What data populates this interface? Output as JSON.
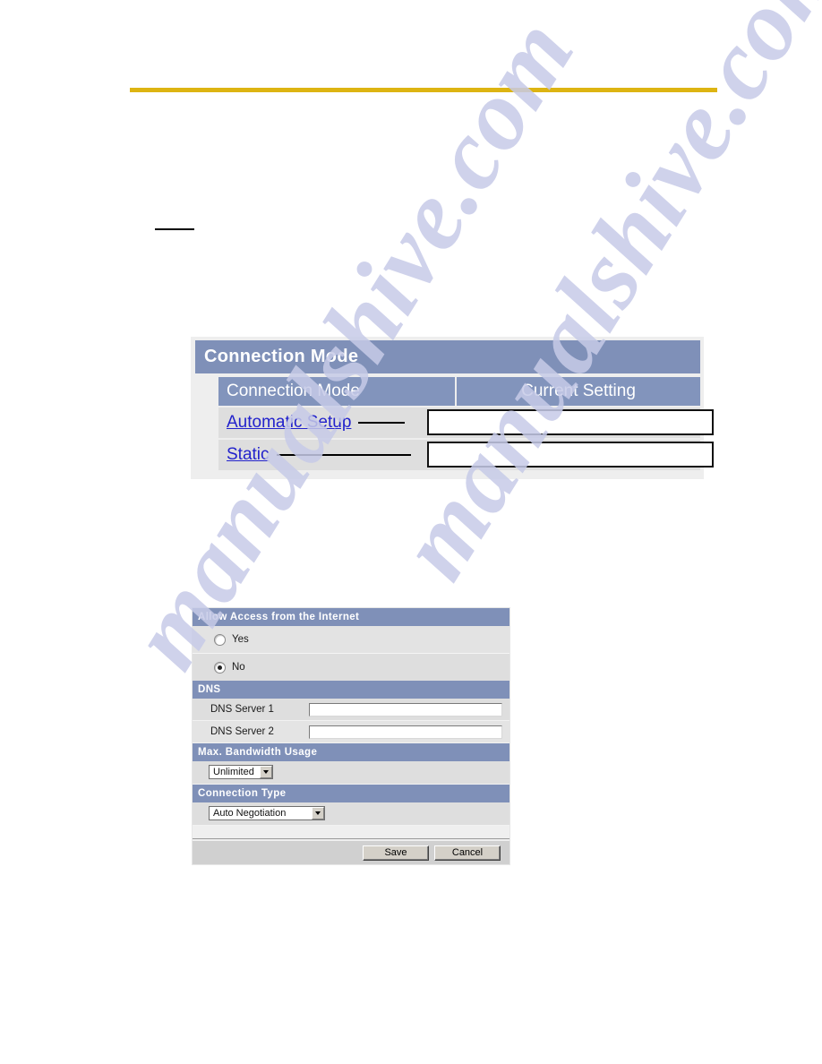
{
  "page": {
    "top_rule_color": "#ddb412",
    "watermark_text": "manualshive.com"
  },
  "connection_mode_panel": {
    "title": "Connection Mode",
    "columns": {
      "mode": "Connection Mode",
      "current_setting": "Current Setting"
    },
    "rows": [
      {
        "link_label": "Automatic Setup",
        "current_setting": ""
      },
      {
        "link_label": "Static",
        "current_setting": ""
      }
    ]
  },
  "settings_panel": {
    "allow_access": {
      "header": "Allow Access from the Internet",
      "options": [
        {
          "label": "Yes",
          "selected": false
        },
        {
          "label": "No",
          "selected": true
        }
      ]
    },
    "dns": {
      "header": "DNS",
      "fields": [
        {
          "label": "DNS Server 1",
          "value": ""
        },
        {
          "label": "DNS Server 2",
          "value": ""
        }
      ]
    },
    "bandwidth": {
      "header": "Max. Bandwidth Usage",
      "selected": "Unlimited"
    },
    "connection_type": {
      "header": "Connection Type",
      "selected": "Auto Negotiation"
    },
    "buttons": {
      "save": "Save",
      "cancel": "Cancel"
    }
  }
}
